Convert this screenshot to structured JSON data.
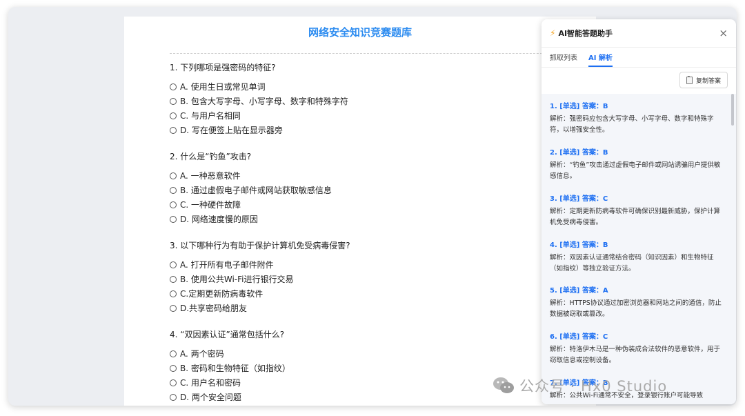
{
  "page": {
    "title": "网络安全知识竞赛题库",
    "questions": [
      {
        "text": "1. 下列哪项是强密码的特征?",
        "options": [
          "A. 使用生日或常见单词",
          "B. 包含大写字母、小写字母、数字和特殊字符",
          "C. 与用户名相同",
          "D. 写在便签上贴在显示器旁"
        ]
      },
      {
        "text": "2. 什么是“钓鱼”攻击?",
        "options": [
          "A. 一种恶意软件",
          "B. 通过虚假电子邮件或网站获取敏感信息",
          "C. 一种硬件故障",
          "D. 网络速度慢的原因"
        ]
      },
      {
        "text": "3. 以下哪种行为有助于保护计算机免受病毒侵害?",
        "options": [
          "A. 打开所有电子邮件附件",
          "B. 使用公共Wi-Fi进行银行交易",
          "C.定期更新防病毒软件",
          "D.共享密码给朋友"
        ]
      },
      {
        "text": "4. “双因素认证”通常包括什么?",
        "options": [
          "A. 两个密码",
          "B. 密码和生物特征（如指纹）",
          "C. 用户名和密码",
          "D. 两个安全问题"
        ]
      }
    ]
  },
  "assistant": {
    "title": "AI智能答题助手",
    "close_label": "×",
    "tabs": [
      "抓取列表",
      "AI 解析"
    ],
    "active_tab": 1,
    "copy_label": "复制答案",
    "answers": [
      {
        "head": "1. [单选] 答案：B",
        "text": "解析：强密码应包含大写字母、小写字母、数字和特殊字符，以增强安全性。"
      },
      {
        "head": "2. [单选] 答案：B",
        "text": "解析：“钓鱼”攻击通过虚假电子邮件或网站诱骗用户提供敏感信息。"
      },
      {
        "head": "3. [单选] 答案：C",
        "text": "解析：定期更新防病毒软件可确保识别最新威胁，保护计算机免受病毒侵害。"
      },
      {
        "head": "4. [单选] 答案：B",
        "text": "解析：双因素认证通常结合密码（知识因素）和生物特征（如指纹）等独立验证方法。"
      },
      {
        "head": "5. [单选] 答案：A",
        "text": "解析：HTTPS协议通过加密浏览器和网站之间的通信，防止数据被窃取或篡改。"
      },
      {
        "head": "6. [单选] 答案：C",
        "text": "解析：特洛伊木马是一种伪装成合法软件的恶意软件，用于窃取信息或控制设备。"
      },
      {
        "head": "7. [单选] 答案：B",
        "text": "解析：公共Wi-Fi通常不安全，登录银行账户可能导致"
      }
    ]
  },
  "watermark": {
    "text": "公众号 · Hx0 Studio"
  },
  "colors": {
    "accent": "#1d6ff2",
    "title_blue": "#2d8cf0",
    "bolt": "#f5a623"
  }
}
